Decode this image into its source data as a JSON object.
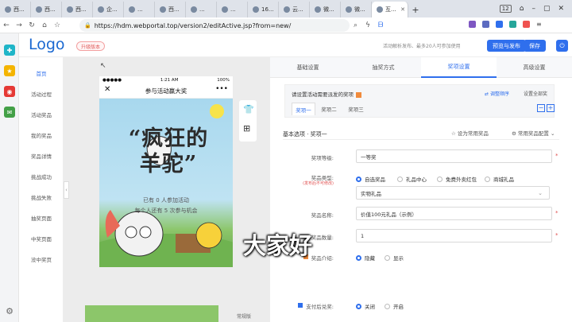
{
  "browser": {
    "tabs": [
      {
        "label": "西..."
      },
      {
        "label": "西..."
      },
      {
        "label": "西..."
      },
      {
        "label": "企..."
      },
      {
        "label": "..."
      },
      {
        "label": "西..."
      },
      {
        "label": "..."
      },
      {
        "label": "..."
      },
      {
        "label": "16..."
      },
      {
        "label": "云..."
      },
      {
        "label": "微..."
      },
      {
        "label": "微..."
      },
      {
        "label": "互..."
      }
    ],
    "new_tab": "+",
    "window_count": "12",
    "url": "https://hdm.webportal.top/version2/editActive.jsp?from=new/",
    "account_glyph": "⌂"
  },
  "app": {
    "logo": "Logo",
    "upgrade_badge": "升级版本",
    "hint": "活动解析发布、最多20人可参加使用",
    "preview_publish": "预览与发布",
    "save": "保存",
    "power_glyph": "⏻"
  },
  "sidebar": {
    "items": [
      {
        "label": "首页"
      },
      {
        "label": "活动过程"
      },
      {
        "label": "活动奖品"
      },
      {
        "label": "我的奖品"
      },
      {
        "label": "奖品详情"
      },
      {
        "label": "挑战成功"
      },
      {
        "label": "挑战失败"
      },
      {
        "label": "抽奖页面"
      },
      {
        "label": "中奖页面"
      },
      {
        "label": "没中奖页"
      }
    ]
  },
  "phone": {
    "signal": "●●●●●",
    "time": "1:21 AM",
    "battery": "100%",
    "title": "参与活动赢大奖",
    "close": "✕",
    "more": "•••",
    "headline_1": "“疯狂的",
    "headline_2": "羊驼”",
    "joined": "已有 0 人参加活动",
    "chances": "每个人还有 5 次参与机会",
    "bottom_label": "常规版"
  },
  "overlay_subtitle": "大家好",
  "panel": {
    "tabs": [
      {
        "label": "基础设置"
      },
      {
        "label": "抽奖方式"
      },
      {
        "label": "奖项设置"
      },
      {
        "label": "高级设置"
      }
    ],
    "level_question": "请设置活动需要派发的奖项",
    "adjust_order": "调整顺序",
    "set_nav": "设置全部奖",
    "level_tabs": [
      {
        "label": "奖项一"
      },
      {
        "label": "奖项二"
      },
      {
        "label": "奖项三"
      }
    ],
    "section_title": "基本选项 · 奖项一",
    "set_common": "设为常用奖品",
    "common_config": "常用奖品配置",
    "fields": {
      "level_label": "奖项等级:",
      "level_value": "一等奖",
      "type_label": "奖品类型:",
      "type_sublabel": "(发布后不可修改)",
      "type_options": [
        {
          "label": "自选奖品"
        },
        {
          "label": "礼品中心"
        },
        {
          "label": "免费外卖红包"
        },
        {
          "label": "商城礼品"
        }
      ],
      "type_select": "实物礼品",
      "name_label": "奖品名称:",
      "name_value": "价值100元礼品（示例）",
      "count_label": "奖品数量:",
      "count_value": "1",
      "intro_label": "奖品介绍:",
      "intro_options": [
        {
          "label": "隐藏"
        },
        {
          "label": "显示"
        }
      ],
      "redeem_label": "支付后兑奖:",
      "redeem_options": [
        {
          "label": "关闭"
        },
        {
          "label": "开启"
        }
      ]
    }
  },
  "colors": {
    "accent": "#2f6fed",
    "badge": "#e05a5a"
  }
}
